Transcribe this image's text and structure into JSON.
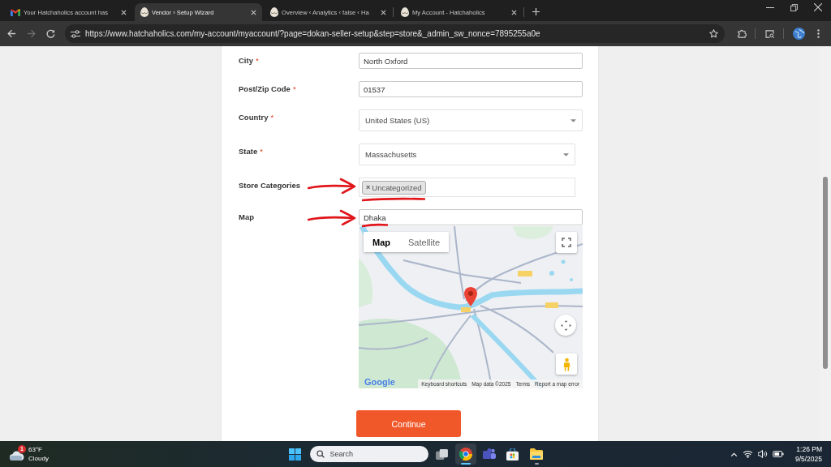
{
  "browser": {
    "tabs": [
      {
        "kind": "gmail",
        "title": "Your Hatchaholics account has",
        "selected": false
      },
      {
        "kind": "site",
        "title": "Vendor › Setup Wizard",
        "selected": true
      },
      {
        "kind": "site",
        "title": "Overview ‹ Analytics ‹ false ‹ Ha",
        "selected": false
      },
      {
        "kind": "site",
        "title": "My Account - Hatchaholics",
        "selected": false
      }
    ],
    "toolbar": {
      "back_disabled": false,
      "forward_disabled": true,
      "url": "https://www.hatchaholics.com/my-account/myaccount/?page=dokan-seller-setup&step=store&_admin_sw_nonce=7895255a0e"
    }
  },
  "form": {
    "fields": [
      {
        "kind": "text",
        "label": "City",
        "marker": "*",
        "value": "North Oxford",
        "annotated": false
      },
      {
        "kind": "text",
        "label": "Post/Zip Code",
        "marker": "*",
        "value": "01537",
        "annotated": false
      },
      {
        "kind": "select",
        "label": "Country",
        "marker": "*",
        "value": "United States (US)",
        "annotated": false
      },
      {
        "kind": "select",
        "label": "State",
        "marker": "*",
        "value": "Massachusetts",
        "annotated": false
      },
      {
        "kind": "tags",
        "label": "Store Categories",
        "tags": [
          {
            "remove": "×",
            "label": "Uncategorized"
          }
        ],
        "annotated": true
      },
      {
        "kind": "map",
        "label": "Map",
        "value": "Dhaka",
        "annotated": true,
        "map": {
          "type_control": [
            {
              "label": "Map",
              "selected": true
            },
            {
              "label": "Satellite",
              "selected": false
            }
          ],
          "logo": "Google",
          "footer": [
            "Keyboard shortcuts",
            "Map data ©2025",
            "Terms",
            "Report a map error"
          ]
        }
      }
    ]
  },
  "continue_button": "Continue",
  "taskbar": {
    "weather": {
      "badge": "1",
      "temperature": "63°F",
      "condition": "Cloudy"
    },
    "search": {
      "placeholder": "Search"
    },
    "apps": [
      {
        "kind": "task-view",
        "selected": false,
        "running": false
      },
      {
        "kind": "chrome",
        "selected": true,
        "running": true
      },
      {
        "kind": "teams",
        "selected": false,
        "running": false
      },
      {
        "kind": "store",
        "selected": false,
        "running": false
      },
      {
        "kind": "explorer",
        "selected": false,
        "running": true
      }
    ],
    "clock": {
      "time": "1:26 PM",
      "date": "9/5/2025"
    }
  }
}
